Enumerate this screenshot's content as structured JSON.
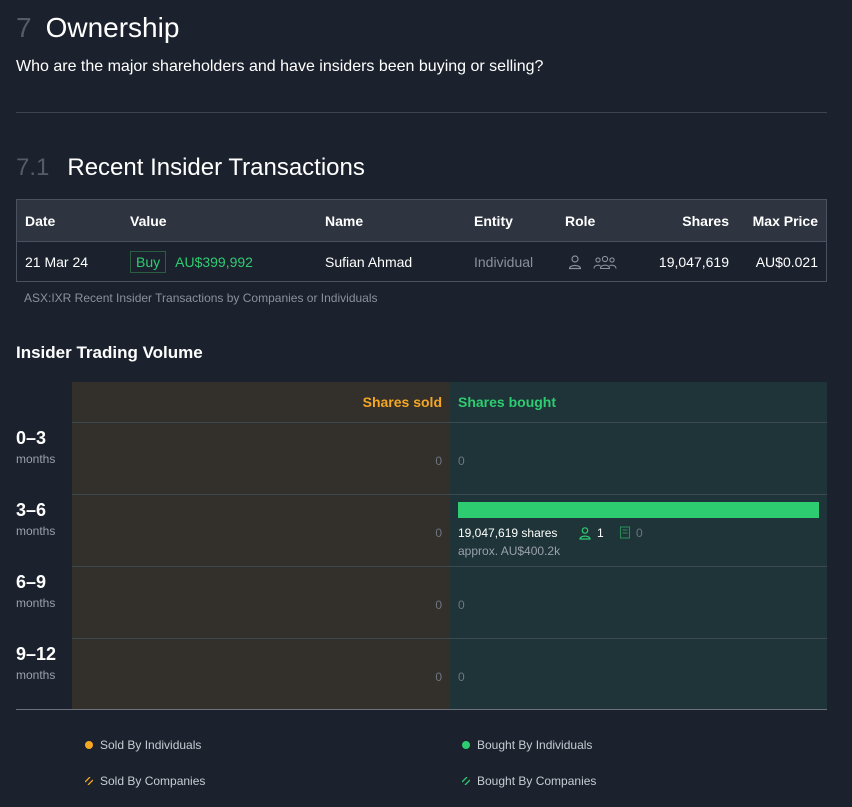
{
  "section": {
    "number": "7",
    "title": "Ownership",
    "subtitle": "Who are the major shareholders and have insiders been buying or selling?"
  },
  "subsection": {
    "number": "7.1",
    "title": "Recent Insider Transactions"
  },
  "transactions": {
    "headers": {
      "date": "Date",
      "value": "Value",
      "name": "Name",
      "entity": "Entity",
      "role": "Role",
      "shares": "Shares",
      "max_price": "Max Price"
    },
    "rows": [
      {
        "date": "21 Mar 24",
        "type": "Buy",
        "value": "AU$399,992",
        "name": "Sufian Ahmad",
        "entity": "Individual",
        "role_icons": [
          "person-icon",
          "group-icon"
        ],
        "shares": "19,047,619",
        "max_price": "AU$0.021"
      }
    ],
    "caption": "ASX:IXR Recent Insider Transactions by Companies or Individuals"
  },
  "volume": {
    "title": "Insider Trading Volume",
    "sold_label": "Shares sold",
    "bought_label": "Shares bought",
    "rows": [
      {
        "range": "0–3",
        "unit": "months",
        "sold": "0",
        "bought": "0"
      },
      {
        "range": "3–6",
        "unit": "months",
        "sold": "0",
        "bought_shares": "19,047,619 shares",
        "bought_approx": "approx. AU$400.2k",
        "individuals": "1",
        "companies": "0",
        "bought_fraction": 1.0
      },
      {
        "range": "6–9",
        "unit": "months",
        "sold": "0",
        "bought": "0"
      },
      {
        "range": "9–12",
        "unit": "months",
        "sold": "0",
        "bought": "0"
      }
    ]
  },
  "legend": {
    "sold_individuals": "Sold By Individuals",
    "sold_companies": "Sold By Companies",
    "bought_individuals": "Bought By Individuals",
    "bought_companies": "Bought By Companies"
  },
  "colors": {
    "background": "#1b222d",
    "sold": "#f5a623",
    "bought": "#2ecc71",
    "sold_panel": "#33302b",
    "bought_panel": "#1e3438"
  }
}
